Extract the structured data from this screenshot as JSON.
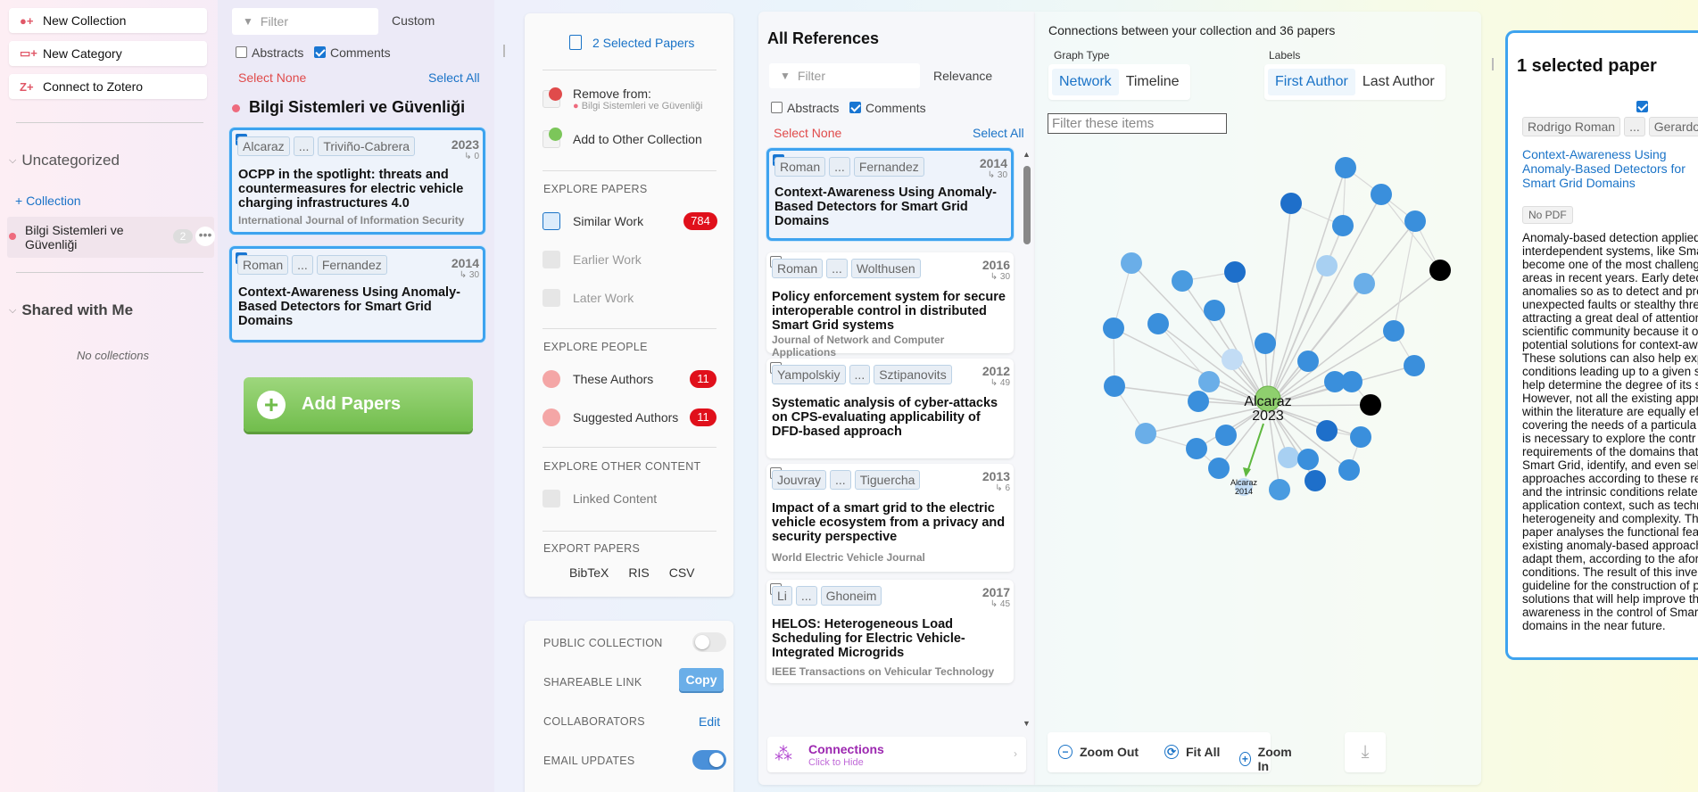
{
  "sidebar": {
    "actions": [
      {
        "label": "New Collection",
        "icon": "new-collection-icon"
      },
      {
        "label": "New Category",
        "icon": "new-category-icon"
      },
      {
        "label": "Connect to Zotero",
        "icon": "zotero-icon"
      }
    ],
    "uncategorized": "Uncategorized",
    "add_collection": "+ Collection",
    "collection": {
      "name": "Bilgi Sistemleri ve Güvenliği",
      "count": "2"
    },
    "shared_title": "Shared with Me",
    "no_collections": "No collections"
  },
  "collection_panel": {
    "filter_placeholder": "Filter",
    "sort": "Custom",
    "abstracts": "Abstracts",
    "comments": "Comments",
    "select_none": "Select None",
    "select_all": "Select All",
    "title": "Bilgi Sistemleri ve Güvenliği",
    "papers": [
      {
        "author1": "Alcaraz",
        "ellipsis": "...",
        "author2": "Triviño-Cabrera",
        "year": "2023",
        "cites": "↳ 0",
        "title": "OCPP in the spotlight: threats and countermeasures for electric vehicle charging infrastructures 4.0",
        "journal": "International Journal of Information Security"
      },
      {
        "author1": "Roman",
        "ellipsis": "...",
        "author2": "Fernandez",
        "year": "2014",
        "cites": "↳ 30",
        "title": "Context-Awareness Using Anomaly-Based Detectors for Smart Grid Domains",
        "journal": ""
      }
    ],
    "add_papers": "Add Papers"
  },
  "actions_panel": {
    "selected": "2 Selected Papers",
    "remove_from": "Remove from:",
    "remove_collection": "Bilgi Sistemleri ve Güvenliği",
    "add_other": "Add to Other Collection",
    "explore_papers": "EXPLORE PAPERS",
    "similar_work": "Similar Work",
    "similar_count": "784",
    "earlier_work": "Earlier Work",
    "later_work": "Later Work",
    "explore_people": "EXPLORE PEOPLE",
    "these_authors": "These Authors",
    "these_count": "11",
    "suggested_authors": "Suggested Authors",
    "suggested_count": "11",
    "explore_other": "EXPLORE OTHER CONTENT",
    "linked_content": "Linked Content",
    "export": "EXPORT PAPERS",
    "export_formats": [
      "BibTeX",
      "RIS",
      "CSV"
    ],
    "public_collection": "PUBLIC COLLECTION",
    "shareable_link": "SHAREABLE LINK",
    "copy": "Copy",
    "collaborators": "COLLABORATORS",
    "edit": "Edit",
    "email_updates": "EMAIL UPDATES"
  },
  "references": {
    "title": "All References",
    "filter_placeholder": "Filter",
    "sort": "Relevance",
    "abstracts": "Abstracts",
    "comments": "Comments",
    "select_none": "Select None",
    "select_all": "Select All",
    "items": [
      {
        "a1": "Roman",
        "a2": "Fernandez",
        "year": "2014",
        "cites": "↳ 30",
        "title": "Context-Awareness Using Anomaly-Based Detectors for Smart Grid Domains",
        "journal": "",
        "checked": true
      },
      {
        "a1": "Roman",
        "a2": "Wolthusen",
        "year": "2016",
        "cites": "↳ 30",
        "title": "Policy enforcement system for secure interoperable control in distributed Smart Grid systems",
        "journal": "Journal of Network and Computer Applications",
        "checked": false
      },
      {
        "a1": "Yampolskiy",
        "a2": "Sztipanovits",
        "year": "2012",
        "cites": "↳ 49",
        "title": "Systematic analysis of cyber-attacks on CPS-evaluating applicability of DFD-based approach",
        "journal": "",
        "checked": false
      },
      {
        "a1": "Jouvray",
        "a2": "Tiguercha",
        "year": "2013",
        "cites": "↳ 6",
        "title": "Impact of a smart grid to the electric vehicle ecosystem from a privacy and security perspective",
        "journal": "World Electric Vehicle Journal",
        "checked": false
      },
      {
        "a1": "Li",
        "a2": "Ghoneim",
        "year": "2017",
        "cites": "↳ 45",
        "title": "HELOS: Heterogeneous Load Scheduling for Electric Vehicle-Integrated Microgrids",
        "journal": "IEEE Transactions on Vehicular Technology",
        "checked": false
      }
    ],
    "ellipsis": "...",
    "connections": "Connections",
    "click_to_hide": "Click to Hide"
  },
  "graph": {
    "header": "Connections between your collection and 36 papers",
    "graph_type_label": "Graph Type",
    "network": "Network",
    "timeline": "Timeline",
    "labels_label": "Labels",
    "first_author": "First Author",
    "last_author": "Last Author",
    "filter_placeholder": "Filter these items",
    "center_label": "Alcaraz",
    "center_year": "2023",
    "small_label": "Alcaraz",
    "small_year": "2014",
    "zoom_out": "Zoom Out",
    "fit_all": "Fit All",
    "zoom_in": "Zoom In"
  },
  "detail": {
    "title": "1 selected paper",
    "authors": [
      "Rodrigo Roman",
      "...",
      "Gerardo F"
    ],
    "paper_title": "Context-Awareness Using Anomaly-Based Detectors for Smart Grid Domains",
    "no_pdf": "No PDF",
    "abstract_lines": [
      "Anomaly-based detection applied",
      "interdependent systems, like Smar",
      "become one of the most challeng",
      "areas in recent years. Early detec",
      "anomalies so as to detect and pre",
      "unexpected faults or stealthy thre",
      "attracting a great deal of attention",
      "scientific community because it o",
      "potential solutions for context-aw",
      "These solutions can also help exp",
      "conditions leading up to a given s",
      "help determine the degree of its s",
      "However, not all the existing appr",
      "within the literature are equally ef",
      "covering the needs of a particula",
      "is necessary to explore the contr",
      "requirements of the domains that",
      "Smart Grid, identify, and even sel",
      "approaches according to these re",
      "and the intrinsic conditions relate",
      "application context, such as techn",
      "heterogeneity and complexity. Th",
      "paper analyses the functional fea",
      "existing anomaly-based approach",
      "adapt them, according to the afor",
      "conditions. The result of this inve",
      "guideline for the construction of p",
      "solutions that will help improve th",
      "awareness in the control of Smar",
      "domains in the near future."
    ]
  },
  "colors": {
    "accent": "#1a73c7",
    "selected_border": "#3ea3ef",
    "badge": "#e0101b",
    "add_papers": "#7cc65a"
  }
}
